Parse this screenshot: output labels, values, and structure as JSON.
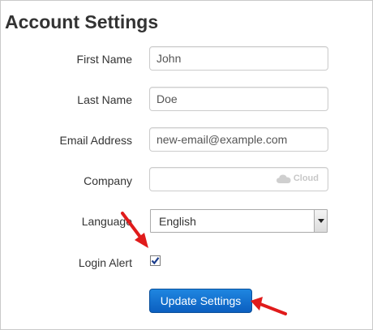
{
  "page": {
    "title": "Account Settings"
  },
  "form": {
    "first_name": {
      "label": "First Name",
      "value": "John"
    },
    "last_name": {
      "label": "Last Name",
      "value": "Doe"
    },
    "email": {
      "label": "Email Address",
      "value": "new-email@example.com"
    },
    "company": {
      "label": "Company",
      "value": "",
      "watermark": "Cloud"
    },
    "language": {
      "label": "Language",
      "selected": "English"
    },
    "login_alert": {
      "label": "Login Alert",
      "checked": true
    },
    "submit": {
      "label": "Update Settings"
    }
  },
  "colors": {
    "button_bg": "#1a73d2",
    "annotation_arrow": "#e01b1b"
  },
  "icons": {
    "select_arrow": "triangle-down-icon",
    "checkbox": "checkmark-icon",
    "watermark": "cloud-icon",
    "annotation": "red-arrow-icon"
  }
}
